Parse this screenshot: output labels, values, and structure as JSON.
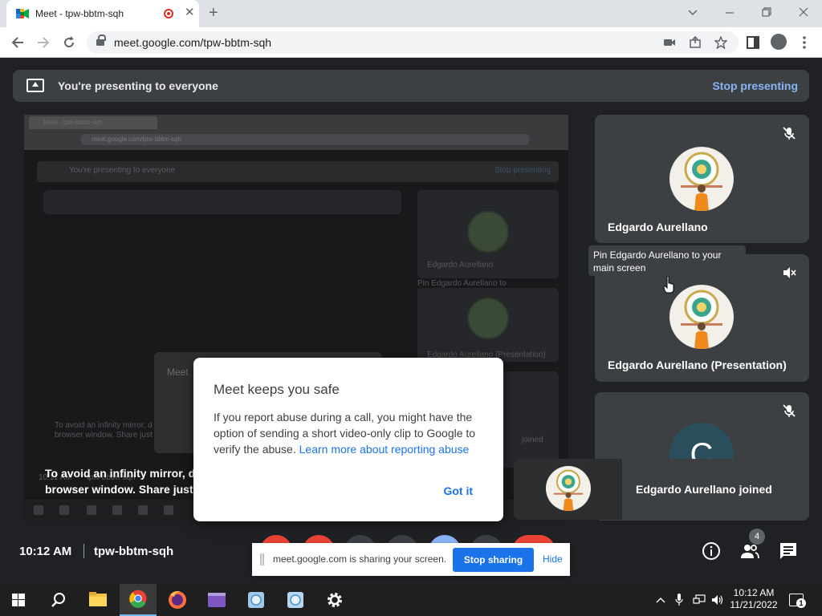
{
  "browser": {
    "tab_title": "Meet - tpw-bbtm-sqh",
    "tab_close": "✕",
    "new_tab": "+",
    "tab_search_icon": "chevron-down-icon",
    "url": "meet.google.com/tpw-bbtm-sqh"
  },
  "meet": {
    "banner": {
      "text": "You're presenting to everyone",
      "stop_label": "Stop presenting"
    },
    "share_preview": {
      "warning_line1": "To avoid an infinity mirror, d",
      "warning_line2": "browser window. Share just",
      "mirror_tab_title": "Meet - tpw-bbtm-sqh",
      "mirror_url": "meet.google.com/tpw-bbtm-sqh",
      "mirror_banner": "You're presenting to everyone",
      "mirror_stop": "Stop presenting",
      "mirror_name_1": "Edgardo Aurellano",
      "mirror_tooltip": "Pin Edgardo Aurellano to your main screen",
      "mirror_name_2": "Edgardo Aurellano (Presentation)",
      "mirror_dialog_title": "Meet",
      "mirror_warning_1": "To avoid an infinity mirror, d",
      "mirror_warning_2": "browser window. Share just",
      "mirror_time": "10:11 AM",
      "mirror_code": "tpw-bbtm-sqh",
      "mirror_joined": "joined"
    },
    "participants": [
      {
        "name": "Edgardo Aurellano",
        "muted": true
      },
      {
        "name": "Edgardo Aurellano (Presentation)",
        "muted": true
      },
      {
        "name": "",
        "initial": "C",
        "muted": true
      }
    ],
    "tooltip": "Pin Edgardo Aurellano to your main screen",
    "toast": {
      "text": "Edgardo Aurellano joined"
    },
    "dialog": {
      "title": "Meet keeps you safe",
      "body": "If you report abuse during a call, you might have the option of sending a short video-only clip to Google to verify the abuse. ",
      "link": "Learn more about reporting abuse",
      "button": "Got it"
    },
    "bottom": {
      "time": "10:12 AM",
      "meeting_code": "tpw-bbtm-sqh",
      "people_count": "4"
    },
    "sharing_bar": {
      "text": "meet.google.com is sharing your screen.",
      "stop_label": "Stop sharing",
      "hide_label": "Hide"
    }
  },
  "taskbar": {
    "time": "10:12 AM",
    "date": "11/21/2022",
    "notifications": "1"
  },
  "colors": {
    "meet_bg": "#202124",
    "tile_bg": "#3c4043",
    "accent_blue": "#1a73e8",
    "link_blue": "#8ab4f8",
    "end_call_red": "#ea4335"
  }
}
